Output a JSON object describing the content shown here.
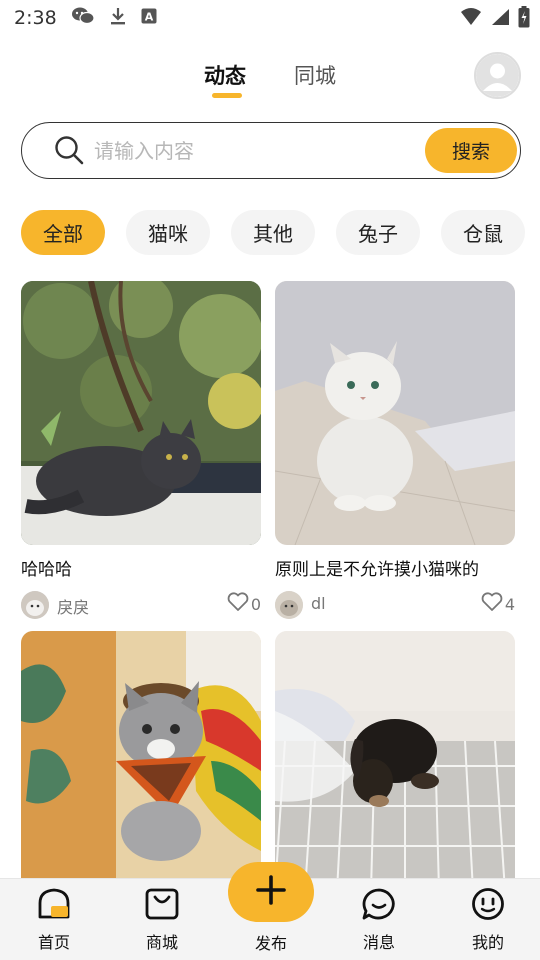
{
  "status_bar": {
    "time": "2:38",
    "icons": [
      "wechat-icon",
      "download-icon",
      "a-badge-icon",
      "wifi-icon",
      "signal-icon",
      "battery-icon"
    ]
  },
  "header": {
    "tabs": [
      {
        "label": "动态",
        "active": true
      },
      {
        "label": "同城",
        "active": false
      }
    ],
    "avatar_icon": "user-avatar-icon"
  },
  "search": {
    "placeholder": "请输入内容",
    "button_label": "搜索"
  },
  "categories": [
    {
      "label": "全部",
      "active": true
    },
    {
      "label": "猫咪",
      "active": false
    },
    {
      "label": "其他",
      "active": false
    },
    {
      "label": "兔子",
      "active": false
    },
    {
      "label": "仓鼠",
      "active": false
    }
  ],
  "feed": [
    {
      "title": "哈哈哈",
      "author": "戾戾",
      "likes": "0",
      "image": "black-cat-on-ledge"
    },
    {
      "title": "原则上是不允许摸小猫咪的",
      "author": "dl",
      "likes": "4",
      "image": "white-persian-cat"
    },
    {
      "title": "",
      "author": "",
      "likes": "",
      "image": "tabby-kitten-with-bandana"
    },
    {
      "title": "",
      "author": "",
      "likes": "",
      "image": "black-puppy-on-wire-rack"
    }
  ],
  "bottom_nav": {
    "items": [
      {
        "label": "首页",
        "icon": "home-icon",
        "active": true
      },
      {
        "label": "商城",
        "icon": "shopping-bag-icon",
        "active": false
      },
      {
        "label": "发布",
        "icon": "plus-icon",
        "active": false
      },
      {
        "label": "消息",
        "icon": "message-icon",
        "active": false
      },
      {
        "label": "我的",
        "icon": "smile-face-icon",
        "active": false
      }
    ]
  },
  "colors": {
    "accent": "#f7b52c",
    "chip_bg": "#f4f4f4",
    "nav_bg": "#f4f4f4",
    "placeholder": "#b7b7b7"
  }
}
